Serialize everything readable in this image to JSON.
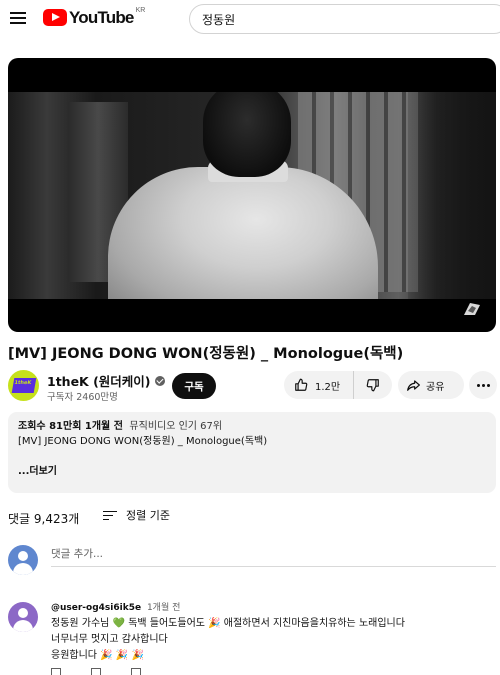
{
  "header": {
    "logo_text": "YouTube",
    "region": "KR",
    "search_value": "정동원"
  },
  "video": {
    "title": "[MV] JEONG DONG WON(정동원) _ Monologue(독백)"
  },
  "channel": {
    "name": "1theK (원더케이)",
    "subscribers": "구독자 2460만명",
    "subscribe_label": "구독"
  },
  "actions": {
    "like_count": "1.2만",
    "share_label": "공유"
  },
  "description": {
    "views": "조회수 81만회",
    "age": "1개월 전",
    "category": "뮤직비디오 인기 67위",
    "text": "[MV] JEONG DONG WON(정동원) _ Monologue(독백)",
    "more_label": "...더보기"
  },
  "comments": {
    "count_label": "댓글 9,423개",
    "sort_label": "정렬 기준",
    "add_placeholder": "댓글 추가...",
    "items": [
      {
        "author": "@user-og4si6ik5e",
        "time": "1개월 전",
        "line1_a": "정동원 가수님 ",
        "line1_heart": "💚",
        "line1_b": " 독백 들어도들어도 🎉 애절하면서 지친마음을치유하는 노래입니다",
        "line2": "너무너무 멋지고 감사합니다",
        "line3": "응원합니다 🎉 🎉 🎉"
      }
    ]
  },
  "colors": {
    "brand_red": "#ff0000",
    "text": "#0f0f0f",
    "secondary_text": "#606060",
    "panel": "#f2f2f2"
  }
}
